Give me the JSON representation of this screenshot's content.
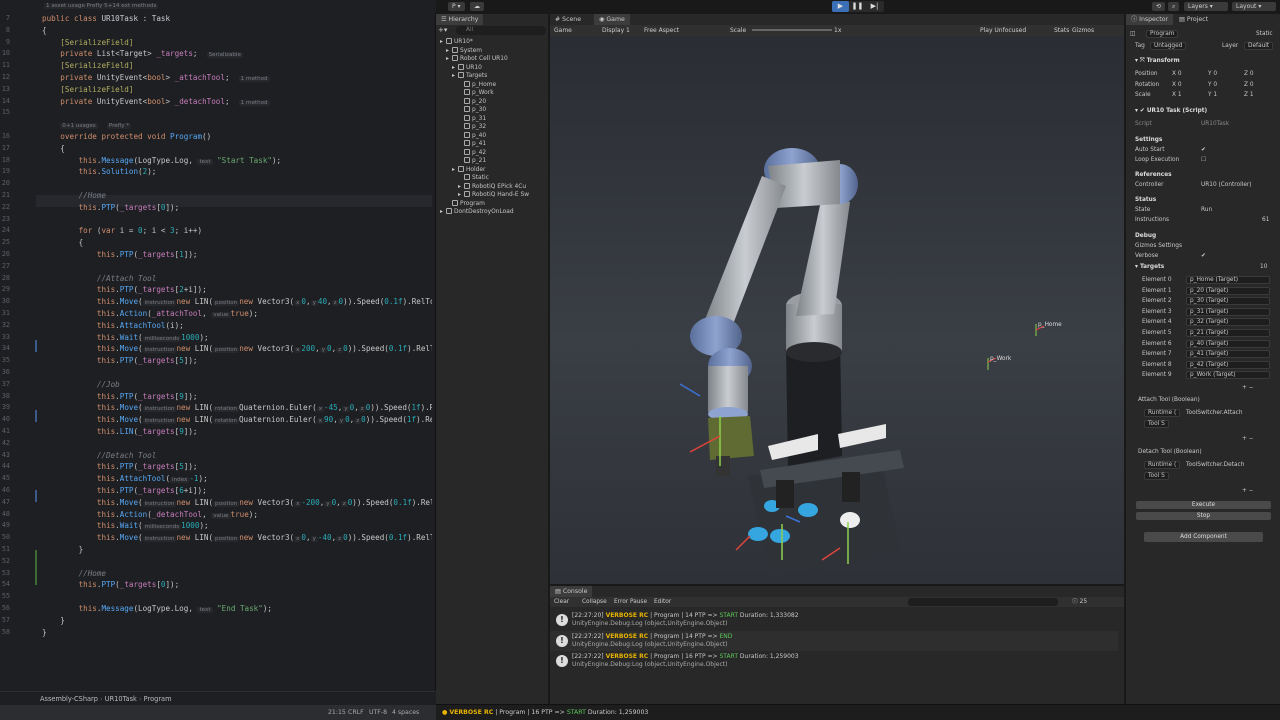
{
  "editor": {
    "top_hint": "1 asset usage   Prefly   5+14 ext methods",
    "breadcrumb": [
      "Assembly-CSharp",
      "UR10Task",
      "Program"
    ],
    "status": {
      "position": "21:15",
      "line_ending": "CRLF",
      "encoding": "UTF-8",
      "indent": "4 spaces"
    },
    "lines": [
      {
        "n": "7",
        "html": "<span class='kw'>public class</span> <span class='cls'>UR10Task</span> : <span class='cls'>Task</span>"
      },
      {
        "n": "8",
        "html": "{"
      },
      {
        "n": "9",
        "html": "    <span class='an'>[SerializeField]</span>"
      },
      {
        "n": "10",
        "html": "    <span class='kw'>private</span> List&lt;Target&gt; <span class='fld'>_targets</span>;  <span class='hint'>Serializable</span>"
      },
      {
        "n": "11",
        "html": "    <span class='an'>[SerializeField]</span>"
      },
      {
        "n": "12",
        "html": "    <span class='kw'>private</span> UnityEvent&lt;<span class='kw'>bool</span>&gt; <span class='fld'>_attachTool</span>;  <span class='hint'>1 method</span>"
      },
      {
        "n": "13",
        "html": "    <span class='an'>[SerializeField]</span>"
      },
      {
        "n": "14",
        "html": "    <span class='kw'>private</span> UnityEvent&lt;<span class='kw'>bool</span>&gt; <span class='fld'>_detachTool</span>;  <span class='hint'>1 method</span>"
      },
      {
        "n": "15",
        "html": ""
      },
      {
        "n": "",
        "html": "    <span class='hint'>0+1 usages</span>  <span class='hint'>Prefly *</span>"
      },
      {
        "n": "16",
        "html": "    <span class='kw'>override protected void</span> <span class='fn'>Program</span>()"
      },
      {
        "n": "17",
        "html": "    {"
      },
      {
        "n": "18",
        "html": "        <span class='kw'>this</span>.<span class='fn'>Message</span>(LogType.Log, <span class='hint'>text</span> <span class='str'>\"Start Task\"</span>);"
      },
      {
        "n": "19",
        "html": "        <span class='kw'>this</span>.<span class='fn'>Solution</span>(<span class='num'>2</span>);"
      },
      {
        "n": "20",
        "html": ""
      },
      {
        "n": "21",
        "html": "        <span class='cm'>//Home</span>"
      },
      {
        "n": "22",
        "html": "        <span class='kw'>this</span>.<span class='fn'>PTP</span>(<span class='fld'>_targets</span>[<span class='num'>0</span>]);"
      },
      {
        "n": "23",
        "html": ""
      },
      {
        "n": "24",
        "html": "        <span class='kw'>for</span> (<span class='kw'>var</span> i = <span class='num'>0</span>; i &lt; <span class='num'>3</span>; i++)"
      },
      {
        "n": "25",
        "html": "        {"
      },
      {
        "n": "26",
        "html": "            <span class='kw'>this</span>.<span class='fn'>PTP</span>(<span class='fld'>_targets</span>[<span class='num'>1</span>]);"
      },
      {
        "n": "27",
        "html": ""
      },
      {
        "n": "28",
        "html": "            <span class='cm'>//Attach Tool</span>"
      },
      {
        "n": "29",
        "html": "            <span class='kw'>this</span>.<span class='fn'>PTP</span>(<span class='fld'>_targets</span>[<span class='num'>2</span>+i]);"
      },
      {
        "n": "30",
        "html": "            <span class='kw'>this</span>.<span class='fn'>Move</span>(<span class='hint'>instruction</span><span class='kw'>new</span> LIN(<span class='hint'>position</span><span class='kw'>new</span> Vector3(<span class='hint'>x</span><span class='num'>0</span>,<span class='hint'>y</span><span class='num'>40</span>,<span class='hint'>z</span><span class='num'>0</span>)).Speed(<span class='num'>0.1f</span>).RelTool("
      },
      {
        "n": "31",
        "html": "            <span class='kw'>this</span>.<span class='fn'>Action</span>(<span class='fld'>_attachTool</span>, <span class='hint'>value</span><span class='kw'>true</span>);"
      },
      {
        "n": "32",
        "html": "            <span class='kw'>this</span>.<span class='fn'>AttachTool</span>(i);"
      },
      {
        "n": "33",
        "html": "            <span class='kw'>this</span>.<span class='fn'>Wait</span>(<span class='hint'>milliseconds</span><span class='num'>1000</span>);"
      },
      {
        "n": "34",
        "html": "            <span class='kw'>this</span>.<span class='fn'>Move</span>(<span class='hint'>instruction</span><span class='kw'>new</span> LIN(<span class='hint'>position</span><span class='kw'>new</span> Vector3(<span class='hint'>x</span><span class='num'>200</span>,<span class='hint'>y</span><span class='num'>0</span>,<span class='hint'>z</span><span class='num'>0</span>)).Speed(<span class='num'>0.1f</span>).RelTool("
      },
      {
        "n": "35",
        "html": "            <span class='kw'>this</span>.<span class='fn'>PTP</span>(<span class='fld'>_targets</span>[<span class='num'>5</span>]);"
      },
      {
        "n": "36",
        "html": ""
      },
      {
        "n": "37",
        "html": "            <span class='cm'>//Job</span>"
      },
      {
        "n": "38",
        "html": "            <span class='kw'>this</span>.<span class='fn'>PTP</span>(<span class='fld'>_targets</span>[<span class='num'>9</span>]);"
      },
      {
        "n": "39",
        "html": "            <span class='kw'>this</span>.<span class='fn'>Move</span>(<span class='hint'>instruction</span><span class='kw'>new</span> LIN(<span class='hint'>rotation</span>Quaternion.Euler(<span class='hint'>x</span><span class='num'>-45</span>,<span class='hint'>y</span><span class='num'>0</span>,<span class='hint'>z</span><span class='num'>0</span>)).Speed(<span class='num'>1f</span>).RelTo"
      },
      {
        "n": "40",
        "html": "            <span class='kw'>this</span>.<span class='fn'>Move</span>(<span class='hint'>instruction</span><span class='kw'>new</span> LIN(<span class='hint'>rotation</span>Quaternion.Euler(<span class='hint'>x</span><span class='num'>90</span>,<span class='hint'>y</span><span class='num'>0</span>,<span class='hint'>z</span><span class='num'>0</span>)).Speed(<span class='num'>1f</span>).RelTo"
      },
      {
        "n": "41",
        "html": "            <span class='kw'>this</span>.<span class='fn'>LIN</span>(<span class='fld'>_targets</span>[<span class='num'>9</span>]);"
      },
      {
        "n": "42",
        "html": ""
      },
      {
        "n": "43",
        "html": "            <span class='cm'>//Detach Tool</span>"
      },
      {
        "n": "44",
        "html": "            <span class='kw'>this</span>.<span class='fn'>PTP</span>(<span class='fld'>_targets</span>[<span class='num'>5</span>]);"
      },
      {
        "n": "45",
        "html": "            <span class='kw'>this</span>.<span class='fn'>AttachTool</span>(<span class='hint'>index</span><span class='num'>-1</span>);"
      },
      {
        "n": "46",
        "html": "            <span class='kw'>this</span>.<span class='fn'>PTP</span>(<span class='fld'>_targets</span>[<span class='num'>6</span>+i]);"
      },
      {
        "n": "47",
        "html": "            <span class='kw'>this</span>.<span class='fn'>Move</span>(<span class='hint'>instruction</span><span class='kw'>new</span> LIN(<span class='hint'>position</span><span class='kw'>new</span> Vector3(<span class='hint'>x</span><span class='num'>-200</span>,<span class='hint'>y</span><span class='num'>0</span>,<span class='hint'>z</span><span class='num'>0</span>)).Speed(<span class='num'>0.1f</span>).RelTool"
      },
      {
        "n": "48",
        "html": "            <span class='kw'>this</span>.<span class='fn'>Action</span>(<span class='fld'>_detachTool</span>, <span class='hint'>value</span><span class='kw'>true</span>);"
      },
      {
        "n": "49",
        "html": "            <span class='kw'>this</span>.<span class='fn'>Wait</span>(<span class='hint'>milliseconds</span><span class='num'>1000</span>);"
      },
      {
        "n": "50",
        "html": "            <span class='kw'>this</span>.<span class='fn'>Move</span>(<span class='hint'>instruction</span><span class='kw'>new</span> LIN(<span class='hint'>position</span><span class='kw'>new</span> Vector3(<span class='hint'>x</span><span class='num'>0</span>,<span class='hint'>y</span><span class='num'>-40</span>,<span class='hint'>z</span><span class='num'>0</span>)).Speed(<span class='num'>0.1f</span>).RelTool("
      },
      {
        "n": "51",
        "html": "        }"
      },
      {
        "n": "52",
        "html": ""
      },
      {
        "n": "53",
        "html": "        <span class='cm'>//Home</span>"
      },
      {
        "n": "54",
        "html": "        <span class='kw'>this</span>.<span class='fn'>PTP</span>(<span class='fld'>_targets</span>[<span class='num'>0</span>]);"
      },
      {
        "n": "55",
        "html": ""
      },
      {
        "n": "56",
        "html": "        <span class='kw'>this</span>.<span class='fn'>Message</span>(LogType.Log, <span class='hint'>text</span> <span class='str'>\"End Task\"</span>);"
      },
      {
        "n": "57",
        "html": "    }"
      },
      {
        "n": "58",
        "html": "}"
      }
    ]
  },
  "unity": {
    "toolbar": {
      "account": "P",
      "layers": "Layers",
      "layout": "Layout"
    },
    "hierarchy": {
      "tab": "Hierarchy",
      "search_placeholder": "All",
      "items": [
        {
          "label": "UR10*"
        },
        {
          "label": "System"
        },
        {
          "label": "Robot Cell UR10"
        },
        {
          "label": "UR10"
        },
        {
          "label": "Targets"
        },
        {
          "label": "p_Home"
        },
        {
          "label": "p_Work"
        },
        {
          "label": "p_20"
        },
        {
          "label": "p_30"
        },
        {
          "label": "p_31"
        },
        {
          "label": "p_32"
        },
        {
          "label": "p_40"
        },
        {
          "label": "p_41"
        },
        {
          "label": "p_42"
        },
        {
          "label": "p_21"
        },
        {
          "label": "Holder"
        },
        {
          "label": "Static"
        },
        {
          "label": "RobotiQ EPick 4Cu"
        },
        {
          "label": "RobotiQ Hand-E Sw"
        },
        {
          "label": "Program"
        },
        {
          "label": "DontDestroyOnLoad"
        }
      ]
    },
    "game": {
      "tabs": [
        "Scene",
        "Game"
      ],
      "display": "Game",
      "display_num": "Display 1",
      "aspect": "Free Aspect",
      "scale_label": "Scale",
      "scale_value": "1x",
      "play_mode": "Play Unfocused",
      "stats": "Stats",
      "gizmos": "Gizmos",
      "labels": {
        "home": "p_Home",
        "work": "p_Work"
      }
    },
    "console": {
      "tab": "Console",
      "buttons": [
        "Clear",
        "Collapse",
        "Error Pause",
        "Editor"
      ],
      "count": "25",
      "rows": [
        {
          "time": "[22:27:20]",
          "tag": "VERBOSE RC",
          "msg": "| Program | 14 PTP => ",
          "state": "START",
          "dur": "Duration: 1,333082",
          "stack": "UnityEngine.Debug:Log (object,UnityEngine.Object)"
        },
        {
          "time": "[22:27:22]",
          "tag": "VERBOSE RC",
          "msg": "| Program | 14 PTP => ",
          "state": "END",
          "dur": "",
          "stack": "UnityEngine.Debug:Log (object,UnityEngine.Object)"
        },
        {
          "time": "[22:27:22]",
          "tag": "VERBOSE RC",
          "msg": "| Program | 16 PTP => ",
          "state": "START",
          "dur": "Duration: 1,259003",
          "stack": "UnityEngine.Debug:Log (object,UnityEngine.Object)"
        }
      ]
    },
    "status_bar": {
      "tag": "VERBOSE RC",
      "msg": "| Program | 16 PTP => ",
      "state": "START",
      "dur": "Duration: 1,259003"
    },
    "inspector": {
      "tabs": [
        "Inspector",
        "Project"
      ],
      "object_name": "Program",
      "static_label": "Static",
      "tag_label": "Tag",
      "tag_value": "Untagged",
      "layer_label": "Layer",
      "layer_value": "Default",
      "transform": {
        "title": "Transform",
        "rows": [
          [
            "Position",
            "0",
            "0",
            "0"
          ],
          [
            "Rotation",
            "0",
            "0",
            "0"
          ],
          [
            "Scale",
            "1",
            "1",
            "1"
          ]
        ]
      },
      "script_component": "UR10 Task (Script)",
      "script_label": "Script",
      "script_value": "UR10Task",
      "settings": "Settings",
      "auto_start": "Auto Start",
      "loop_exec": "Loop Execution",
      "references": "References",
      "controller_label": "Controller",
      "controller_value": "UR10 (Controller)",
      "status": "Status",
      "state_label": "State",
      "state_value": "Run",
      "instructions_label": "Instructions",
      "instructions_value": "61",
      "debug": "Debug",
      "gizmos_settings": "Gizmos Settings",
      "verbose": "Verbose",
      "targets_label": "Targets",
      "targets_count": "10",
      "elements": [
        [
          "Element 0",
          "p_Home (Target)"
        ],
        [
          "Element 1",
          "p_20 (Target)"
        ],
        [
          "Element 2",
          "p_30 (Target)"
        ],
        [
          "Element 3",
          "p_31 (Target)"
        ],
        [
          "Element 4",
          "p_32 (Target)"
        ],
        [
          "Element 5",
          "p_21 (Target)"
        ],
        [
          "Element 6",
          "p_40 (Target)"
        ],
        [
          "Element 7",
          "p_41 (Target)"
        ],
        [
          "Element 8",
          "p_42 (Target)"
        ],
        [
          "Element 9",
          "p_Work (Target)"
        ]
      ],
      "attach_tool": {
        "title": "Attach Tool (Boolean)",
        "runtime": "Runtime (",
        "func": "ToolSwitcher.Attach",
        "obj": "Tool S"
      },
      "detach_tool": {
        "title": "Detach Tool (Boolean)",
        "runtime": "Runtime (",
        "func": "ToolSwitcher.Detach",
        "obj": "Tool S"
      },
      "execute": "Execute",
      "stop": "Stop",
      "add_component": "Add Component"
    }
  }
}
